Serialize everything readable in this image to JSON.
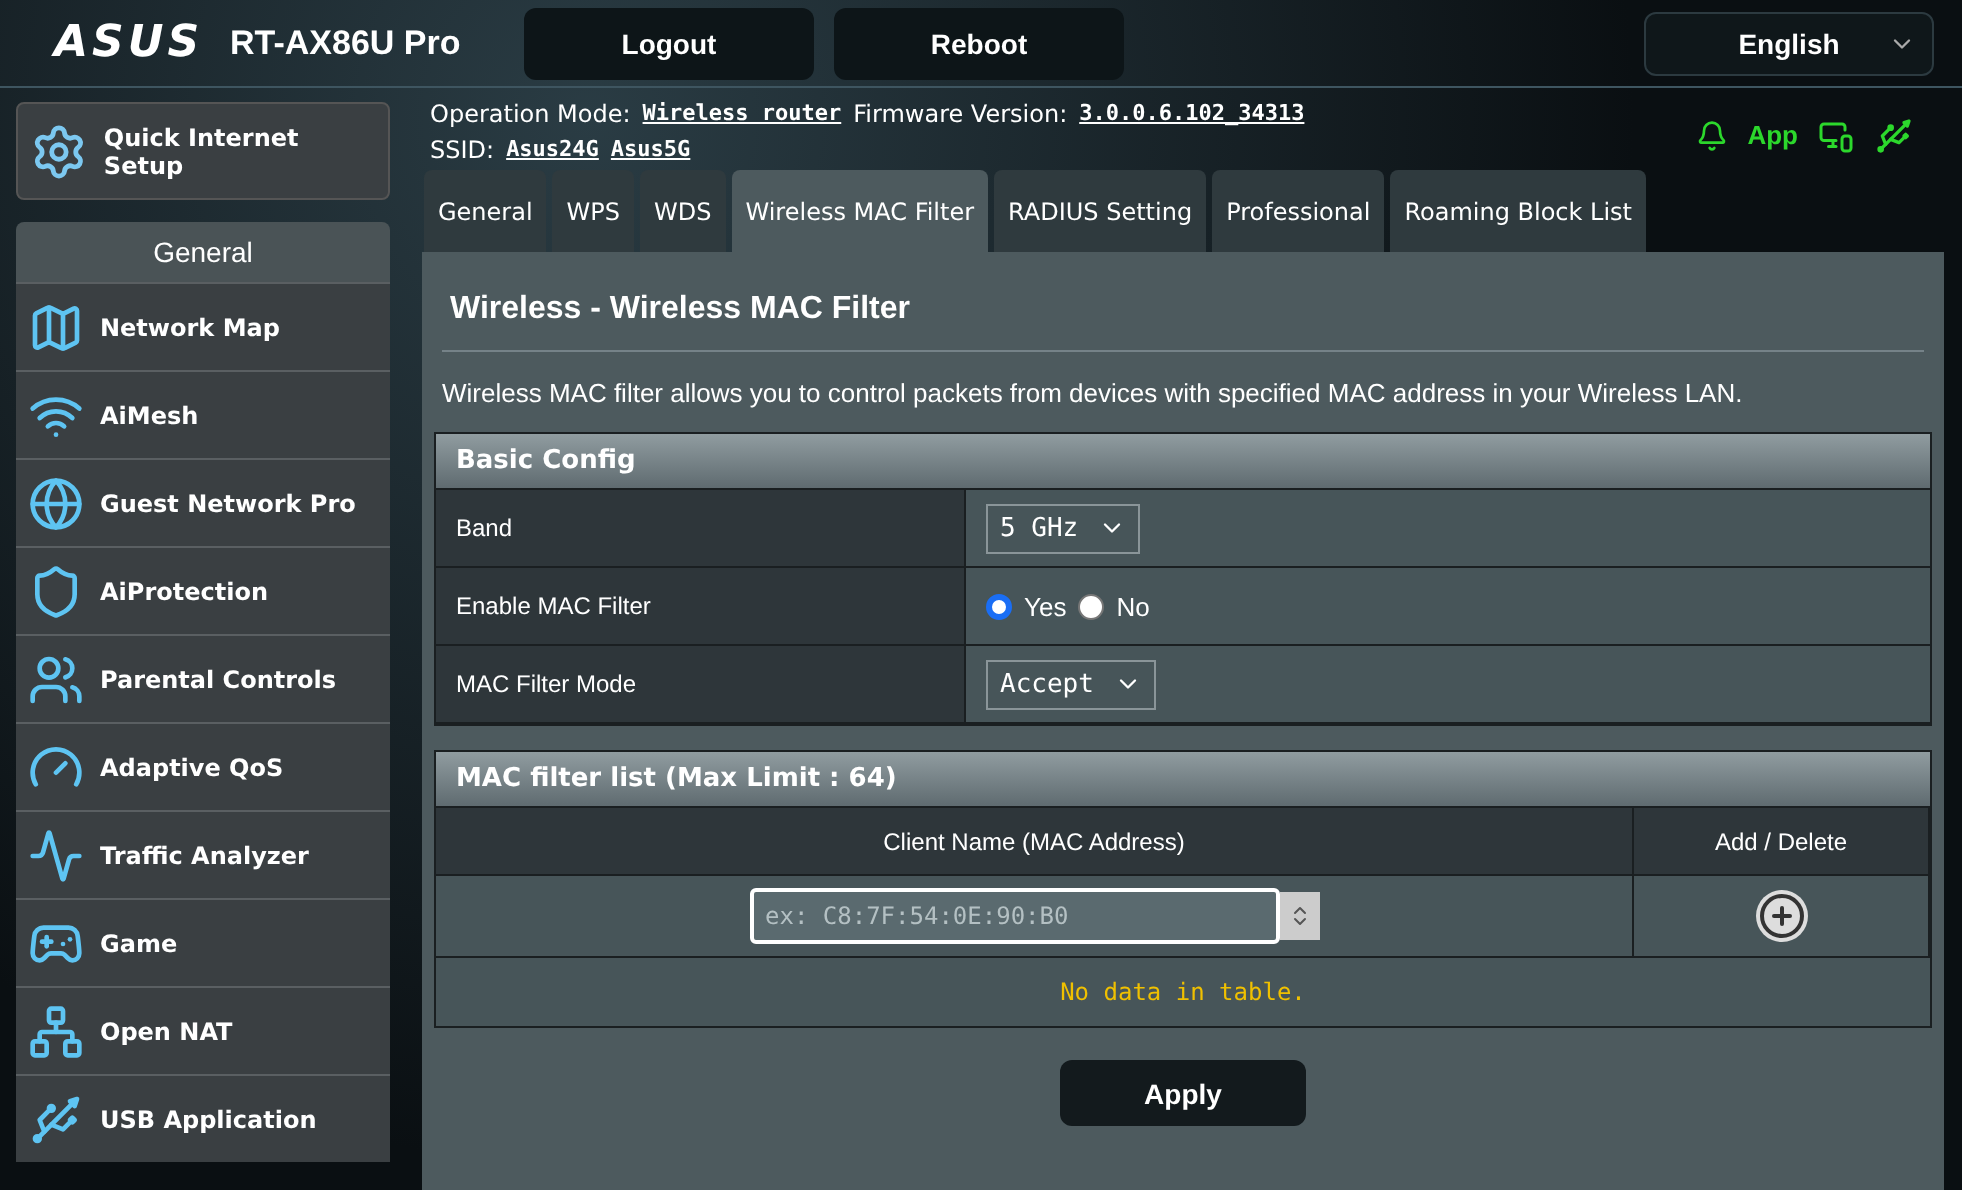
{
  "header": {
    "logo": "ASUS",
    "model": "RT-AX86U Pro",
    "buttons": [
      "Logout",
      "Reboot"
    ],
    "language": "English"
  },
  "sidebar": {
    "quick_setup": "Quick Internet Setup",
    "section": "General",
    "items": [
      {
        "label": "Network Map",
        "kind": "map"
      },
      {
        "label": "AiMesh",
        "kind": "mesh"
      },
      {
        "label": "Guest Network Pro",
        "kind": "guest"
      },
      {
        "label": "AiProtection",
        "kind": "shield"
      },
      {
        "label": "Parental Controls",
        "kind": "family"
      },
      {
        "label": "Adaptive QoS",
        "kind": "gauge"
      },
      {
        "label": "Traffic Analyzer",
        "kind": "pulse"
      },
      {
        "label": "Game",
        "kind": "game"
      },
      {
        "label": "Open NAT",
        "kind": "nat"
      },
      {
        "label": "USB Application",
        "kind": "usb"
      }
    ]
  },
  "info": {
    "mode_label": "Operation Mode:",
    "mode": "Wireless router",
    "firmware_label": "Firmware Version:",
    "firmware": "3.0.0.6.102_34313",
    "ssid_label": "SSID:",
    "ssids": [
      "Asus24G",
      "Asus5G"
    ],
    "app": "App"
  },
  "tabs": [
    {
      "label": "General",
      "selected": false
    },
    {
      "label": "WPS",
      "selected": false
    },
    {
      "label": "WDS",
      "selected": false
    },
    {
      "label": "Wireless MAC Filter",
      "selected": true
    },
    {
      "label": "RADIUS Setting",
      "selected": false
    },
    {
      "label": "Professional",
      "selected": false
    },
    {
      "label": "Roaming Block List",
      "selected": false
    }
  ],
  "page": {
    "title": "Wireless - Wireless MAC Filter",
    "description": "Wireless MAC filter allows you to control packets from devices with specified MAC address in your Wireless LAN."
  },
  "basic_config": {
    "title": "Basic Config",
    "rows": [
      {
        "label": "Band",
        "kind": "select",
        "value": "5 GHz"
      },
      {
        "label": "Enable MAC Filter",
        "kind": "radio",
        "options": [
          {
            "label": "Yes",
            "selected": true
          },
          {
            "label": "No",
            "selected": false
          }
        ]
      },
      {
        "label": "MAC Filter Mode",
        "kind": "select",
        "value": "Accept"
      }
    ]
  },
  "mac_list": {
    "title": "MAC filter list (Max Limit : 64)",
    "columns": [
      "Client Name (MAC Address)",
      "Add / Delete"
    ],
    "placeholder": "ex: C8:7F:54:0E:90:B0",
    "empty": "No data in table."
  },
  "apply": "Apply"
}
